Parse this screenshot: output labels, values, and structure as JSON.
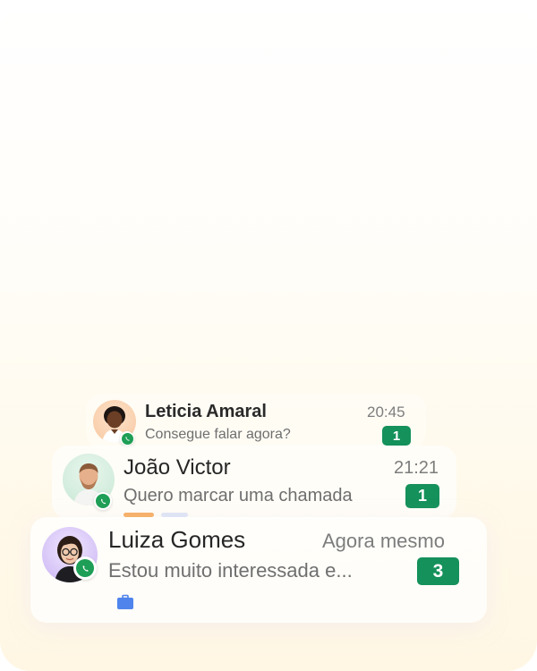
{
  "chats": [
    {
      "name": "Leticia Amaral",
      "time": "20:45",
      "message": "Consegue falar agora?",
      "unread": "1",
      "channel_icon": "whatsapp-icon"
    },
    {
      "name": "João Victor",
      "time": "21:21",
      "message": "Quero marcar uma chamada",
      "unread": "1",
      "channel_icon": "whatsapp-icon"
    },
    {
      "name": "Luiza Gomes",
      "time": "Agora mesmo",
      "message": "Estou muito interessada e...",
      "unread": "3",
      "channel_icon": "whatsapp-icon",
      "label_icon": "briefcase-icon"
    }
  ],
  "colors": {
    "badge": "#15915b",
    "whatsapp": "#1e9e56",
    "briefcase": "#4f84ec",
    "tag_orange": "#f59a3a"
  }
}
